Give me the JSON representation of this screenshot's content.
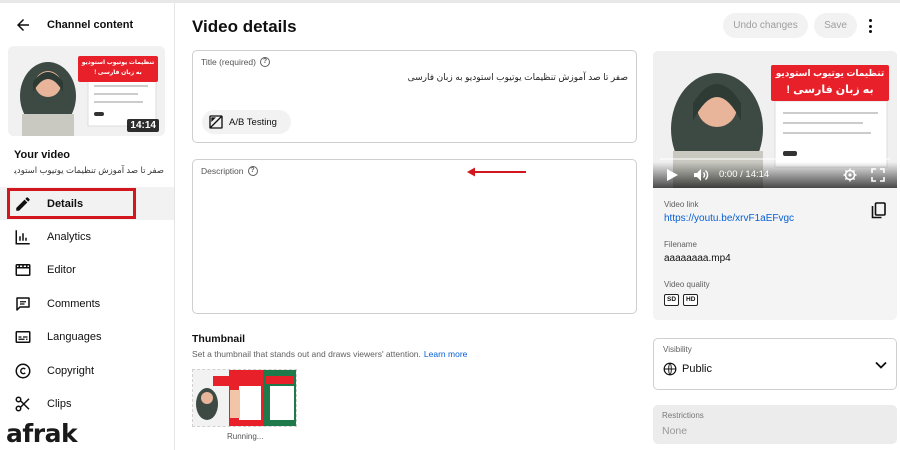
{
  "sidebar": {
    "back_label": "Channel content",
    "your_video_label": "Your video",
    "video_title": "صفر تا صد آموزش تنظیمات یوتیوب استودیو به زبان فارسی",
    "duration": "14:14",
    "thumb_banner": "تنظیمات یوتیوب استودیو\nبه زبان فارسی !",
    "items": [
      {
        "label": "Details",
        "icon": "pencil-icon",
        "active": true
      },
      {
        "label": "Analytics",
        "icon": "analytics-icon"
      },
      {
        "label": "Editor",
        "icon": "editor-icon"
      },
      {
        "label": "Comments",
        "icon": "comments-icon"
      },
      {
        "label": "Languages",
        "icon": "languages-icon"
      },
      {
        "label": "Copyright",
        "icon": "copyright-icon"
      },
      {
        "label": "Clips",
        "icon": "scissors-icon"
      }
    ]
  },
  "watermark": "afrak",
  "header": {
    "title": "Video details",
    "undo_label": "Undo changes",
    "save_label": "Save"
  },
  "title_field": {
    "label": "Title (required)",
    "value": "صفر تا صد آموزش تنظیمات یوتیوب استودیو به زبان فارسی",
    "ab_label": "A/B Testing"
  },
  "description_field": {
    "label": "Description",
    "value": ""
  },
  "thumbnail": {
    "heading": "Thumbnail",
    "subtext": "Set a thumbnail that stands out and draws viewers' attention.",
    "learn_more": "Learn more",
    "status": "Running..."
  },
  "preview": {
    "banner_line1": "تنظیمات یوتیوب استودیو",
    "banner_line2": "به زبان فارسی !",
    "time": "0:00 / 14:14",
    "video_link_label": "Video link",
    "video_link": "https://youtu.be/xrvF1aEFvgc",
    "filename_label": "Filename",
    "filename": "aaaaaaaa.mp4",
    "quality_label": "Video quality",
    "quality_badges": [
      "SD",
      "HD"
    ]
  },
  "visibility": {
    "label": "Visibility",
    "value": "Public"
  },
  "restrictions": {
    "label": "Restrictions",
    "value": "None"
  },
  "colors": {
    "highlight": "#d3161e",
    "link": "#065fd4",
    "banner_red": "#e8202a"
  }
}
